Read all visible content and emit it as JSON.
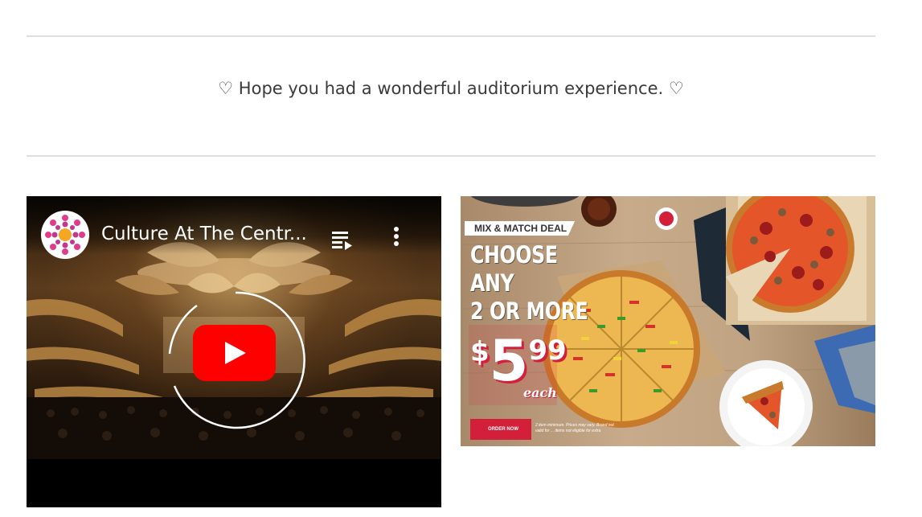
{
  "message": {
    "text": "♡ Hope you had a wonderful auditorium experience. ♡"
  },
  "video": {
    "title": "Culture At The Centr...",
    "channel_avatar_icon": "flower-mandala-logo",
    "playlist_icon": "playlist-icon",
    "more_icon": "more-vertical-icon",
    "play_icon": "youtube-play-icon",
    "colors": {
      "play_red": "#ff0000",
      "background": "#000000"
    }
  },
  "ad": {
    "badge": "MIX & MATCH DEAL",
    "headline": "CHOOSE ANY\n2 OR MORE",
    "price_dollar": "$",
    "price_whole": "5",
    "price_cents": "99",
    "price_suffix": "each",
    "order_button": "ORDER NOW",
    "fine_print": "2 item minimum. Prices may vary. Brand not valid for ... items not eligible for extra",
    "colors": {
      "accent_red": "#d41f3a",
      "text": "#ffffff"
    }
  },
  "colors": {
    "divider": "#dedede",
    "message_text": "#3a3a3a",
    "page_background": "#ffffff"
  }
}
